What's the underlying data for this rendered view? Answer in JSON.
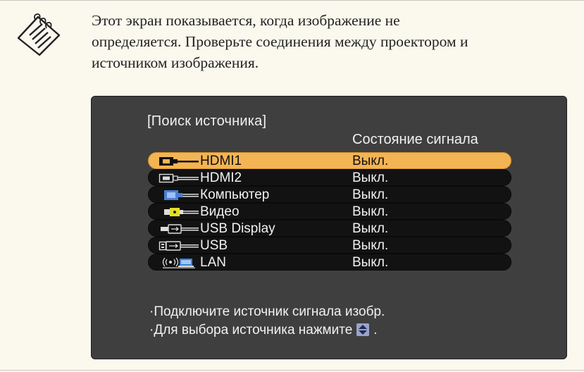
{
  "note": {
    "icon": "note-icon",
    "lines": [
      "Этот экран показывается, когда изображение не",
      "определяется. Проверьте соединения между проектором и",
      "источником изображения."
    ]
  },
  "screen": {
    "title": "[Поиск источника]",
    "status_header": "Состояние сигнала",
    "sources": [
      {
        "label": "HDMI1",
        "status": "Выкл.",
        "icon": "hdmi-icon",
        "selected": true
      },
      {
        "label": "HDMI2",
        "status": "Выкл.",
        "icon": "hdmi-icon",
        "selected": false
      },
      {
        "label": "Компьютер",
        "status": "Выкл.",
        "icon": "vga-computer-icon",
        "selected": false
      },
      {
        "label": "Видео",
        "status": "Выкл.",
        "icon": "composite-video-icon",
        "selected": false
      },
      {
        "label": "USB Display",
        "status": "Выкл.",
        "icon": "usb-display-icon",
        "selected": false
      },
      {
        "label": "USB",
        "status": "Выкл.",
        "icon": "usb-icon",
        "selected": false
      },
      {
        "label": "LAN",
        "status": "Выкл.",
        "icon": "wireless-lan-icon",
        "selected": false
      }
    ],
    "hints": [
      "·Подключите источник сигнала изобр.",
      "·Для выбора источника нажмите",
      "."
    ]
  },
  "colors": {
    "note_background": "#fbf9ee",
    "screen_background": "#3f3f3f",
    "row_background": "#121212",
    "selected_row": "#f3b454"
  }
}
